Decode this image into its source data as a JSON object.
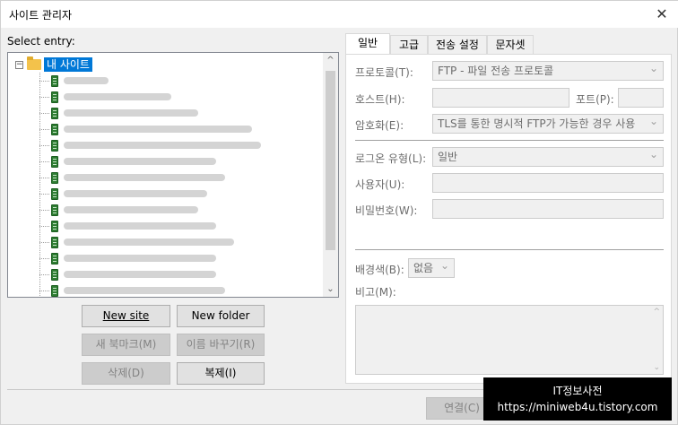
{
  "window": {
    "title": "사이트 관리자",
    "close_label": "✕"
  },
  "left": {
    "select_label": "Select entry:",
    "tree": {
      "root_label": "내 사이트",
      "expander": "−",
      "items": [
        {
          "text_width": 50
        },
        {
          "text_width": 120
        },
        {
          "text_width": 150
        },
        {
          "text_width": 210
        },
        {
          "text_width": 220
        },
        {
          "text_width": 170
        },
        {
          "text_width": 180
        },
        {
          "text_width": 160
        },
        {
          "text_width": 150
        },
        {
          "text_width": 170
        },
        {
          "text_width": 190
        },
        {
          "text_width": 170
        },
        {
          "text_width": 170
        },
        {
          "text_width": 180
        },
        {
          "text_width": 120
        }
      ],
      "scroll_up": "^",
      "scroll_down": "⌄"
    },
    "buttons": {
      "new_site": "New site",
      "new_folder": "New folder",
      "new_bookmark": "새 북마크(M)",
      "rename": "이름 바꾸기(R)",
      "delete": "삭제(D)",
      "duplicate": "복제(I)"
    }
  },
  "tabs": [
    {
      "label": "일반"
    },
    {
      "label": "고급"
    },
    {
      "label": "전송 설정"
    },
    {
      "label": "문자셋"
    }
  ],
  "general": {
    "protocol_label": "프로토콜(T):",
    "protocol_value": "FTP - 파일 전송 프로토콜",
    "host_label": "호스트(H):",
    "host_value": "",
    "port_label": "포트(P):",
    "port_value": "",
    "encryption_label": "암호화(E):",
    "encryption_value": "TLS를 통한 명시적 FTP가 가능한 경우 사용",
    "logon_label": "로그온 유형(L):",
    "logon_value": "일반",
    "user_label": "사용자(U):",
    "user_value": "",
    "password_label": "비밀번호(W):",
    "password_value": "",
    "bg_color_label": "배경색(B):",
    "bg_color_value": "없음",
    "comments_label": "비고(M):"
  },
  "footer": {
    "connect_label": "연결(C)"
  },
  "watermark": {
    "line1": "IT정보사전",
    "line2": "https://miniweb4u.tistory.com"
  }
}
